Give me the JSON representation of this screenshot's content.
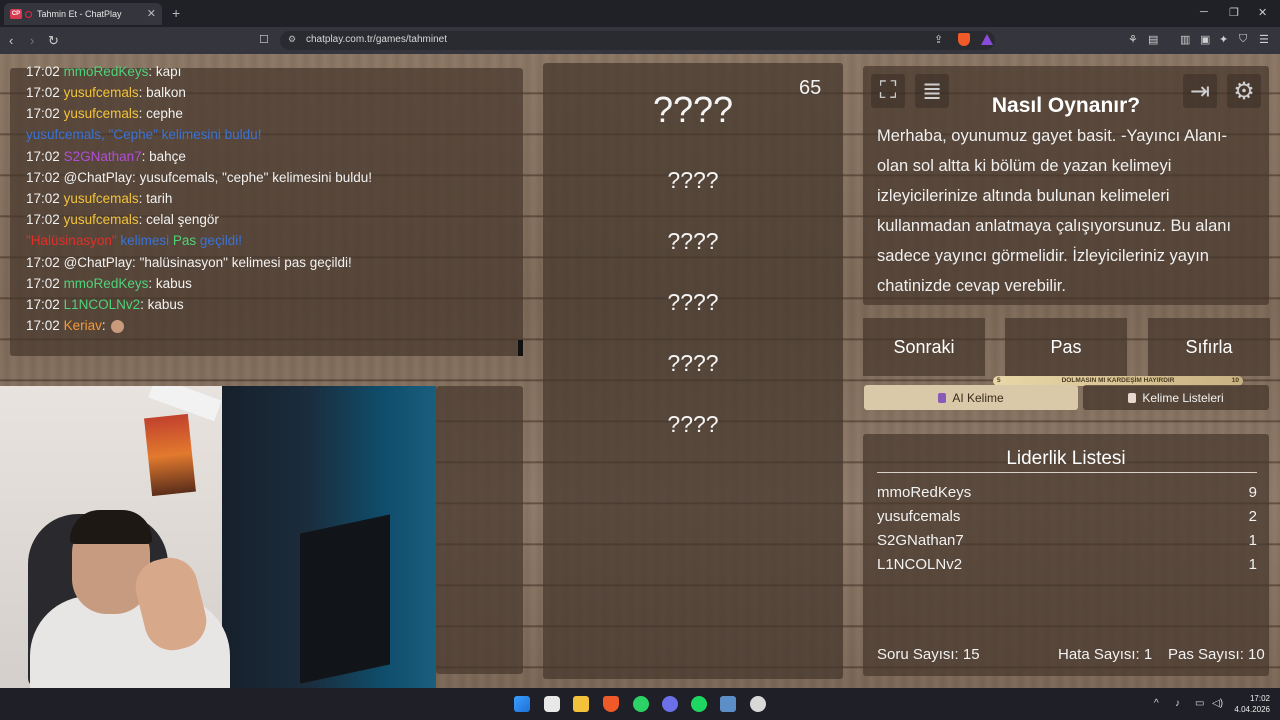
{
  "browser": {
    "tab_favicon": "CP",
    "tab_title": "Tahmin Et - ChatPlay",
    "url": "chatplay.com.tr/games/tahminet"
  },
  "chat": {
    "lines": [
      {
        "time": "17:02",
        "user": "mmoRedKeys",
        "color": "#4fd27a",
        "text": "kapı"
      },
      {
        "time": "17:02",
        "user": "yusufcemals",
        "color": "#f2c33a",
        "text": "balkon"
      },
      {
        "time": "17:02",
        "user": "yusufcemals",
        "color": "#f2c33a",
        "text": "cephe"
      },
      {
        "system": true,
        "text": "yusufcemals, \"Cephe\" kelimesini buldu!",
        "color": "#3a73d8"
      },
      {
        "time": "17:02",
        "user": "S2GNathan7",
        "color": "#b04fd6",
        "text": "bahçe"
      },
      {
        "time": "17:02",
        "user": "@ChatPlay",
        "color": "#f2f2f2",
        "text": "yusufcemals, \"cephe\" kelimesini buldu!"
      },
      {
        "time": "17:02",
        "user": "yusufcemals",
        "color": "#f2c33a",
        "text": "tarih"
      },
      {
        "time": "17:02",
        "user": "yusufcemals",
        "color": "#f2c33a",
        "text": "celal şengör"
      },
      {
        "system_pass": true,
        "word": "\"Halüsinasyon\"",
        "mid": " kelimesi ",
        "pas": "Pas",
        "end": " geçildi!"
      },
      {
        "time": "17:02",
        "user": "@ChatPlay",
        "color": "#f2f2f2",
        "text": "\"halüsinasyon\" kelimesi pas geçildi!"
      },
      {
        "time": "17:02",
        "user": "mmoRedKeys",
        "color": "#4fd27a",
        "text": "kabus"
      },
      {
        "time": "17:02",
        "user": "L1NCOLNv2",
        "color": "#4fd27a",
        "text": "kabus"
      },
      {
        "time": "17:02",
        "user": "Keriav",
        "color": "#f29a3a",
        "text": ""
      }
    ]
  },
  "game": {
    "timer": "65",
    "main_word": "????",
    "words": [
      "????",
      "????",
      "????",
      "????",
      "????"
    ]
  },
  "info": {
    "title": "Nasıl Oynanır?",
    "text": "Merhaba, oyunumuz gayet basit. -Yayıncı Alanı- olan sol altta ki bölüm de yazan kelimeyi izleyicilerinize altında bulunan kelimeleri kullanmadan anlatmaya çalışıyorsunuz. Bu alanı sadece yayıncı görmelidir. İzleyicileriniz yayın chatinizde cevap verebilir.",
    "icons": [
      "fullscreen-icon",
      "notes-icon",
      "exit-icon",
      "gear-icon"
    ]
  },
  "actions": {
    "next": "Sonraki",
    "pass": "Pas",
    "reset": "Sıfırla",
    "banner_text": "DOLMASIN MI KARDEŞİM HAYIRDIR",
    "banner_left": "5",
    "banner_right": "10",
    "ai_word": "AI Kelime",
    "word_lists": "Kelime Listeleri"
  },
  "leaderboard": {
    "title": "Liderlik Listesi",
    "rows": [
      {
        "name": "mmoRedKeys",
        "score": "9"
      },
      {
        "name": "yusufcemals",
        "score": "2"
      },
      {
        "name": "S2GNathan7",
        "score": "1"
      },
      {
        "name": "L1NCOLNv2",
        "score": "1"
      }
    ],
    "questions": "Soru Sayısı: 15",
    "errors": "Hata Sayısı: 1",
    "passes": "Pas Sayısı: 10"
  },
  "taskbar": {
    "time": "17:02",
    "date": "4.04.2026"
  }
}
